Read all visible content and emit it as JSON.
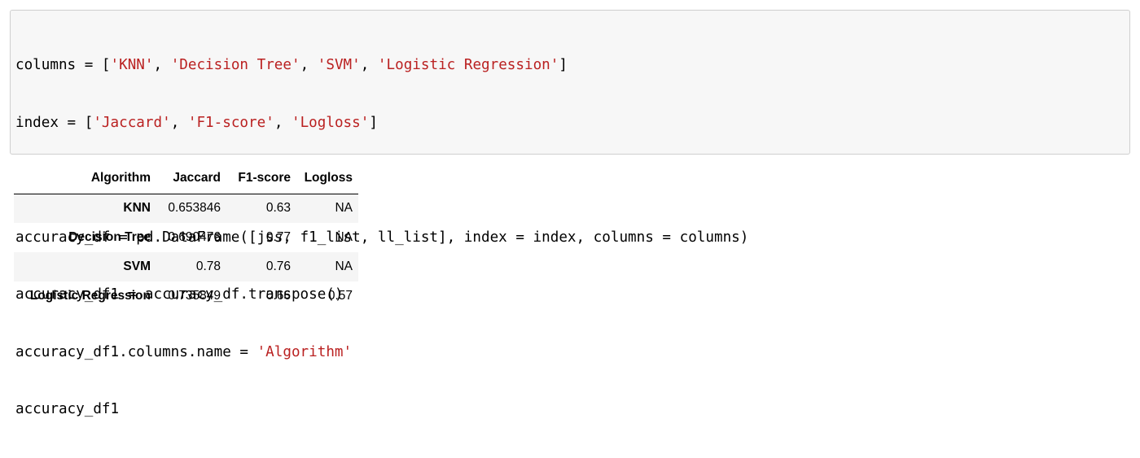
{
  "code_cell": {
    "lines": [
      [
        {
          "t": "plain",
          "v": "columns = ["
        },
        {
          "t": "str",
          "v": "'KNN'"
        },
        {
          "t": "plain",
          "v": ", "
        },
        {
          "t": "str",
          "v": "'Decision Tree'"
        },
        {
          "t": "plain",
          "v": ", "
        },
        {
          "t": "str",
          "v": "'SVM'"
        },
        {
          "t": "plain",
          "v": ", "
        },
        {
          "t": "str",
          "v": "'Logistic Regression'"
        },
        {
          "t": "plain",
          "v": "]"
        }
      ],
      [
        {
          "t": "plain",
          "v": "index = ["
        },
        {
          "t": "str",
          "v": "'Jaccard'"
        },
        {
          "t": "plain",
          "v": ", "
        },
        {
          "t": "str",
          "v": "'F1-score'"
        },
        {
          "t": "plain",
          "v": ", "
        },
        {
          "t": "str",
          "v": "'Logloss'"
        },
        {
          "t": "plain",
          "v": "]"
        }
      ],
      [],
      [
        {
          "t": "plain",
          "v": "accuracy_df = pd.DataFrame([jss, f1_list, ll_list], index = index, columns = columns)"
        }
      ],
      [
        {
          "t": "plain",
          "v": "accuracy_df1 = accuracy_df.transpose()"
        }
      ],
      [
        {
          "t": "plain",
          "v": "accuracy_df1.columns.name = "
        },
        {
          "t": "str",
          "v": "'Algorithm'"
        }
      ],
      [
        {
          "t": "plain",
          "v": "accuracy_df1"
        }
      ]
    ]
  },
  "output_table": {
    "columns_name": "Algorithm",
    "headers": [
      "Jaccard",
      "F1-score",
      "Logloss"
    ],
    "rows": [
      {
        "index": "KNN",
        "values": [
          "0.653846",
          "0.63",
          "NA"
        ]
      },
      {
        "index": "Decision Tree",
        "values": [
          "0.690476",
          "0.77",
          "NA"
        ]
      },
      {
        "index": "SVM",
        "values": [
          "0.78",
          "0.76",
          "NA"
        ]
      },
      {
        "index": "Logistic Regression",
        "values": [
          "0.735849",
          "0.66",
          "0.57"
        ]
      }
    ]
  },
  "colors": {
    "string_literal": "#ba2121",
    "code_background": "#f7f7f7",
    "code_border": "#cfcfcf",
    "row_stripe": "#f5f5f5"
  }
}
